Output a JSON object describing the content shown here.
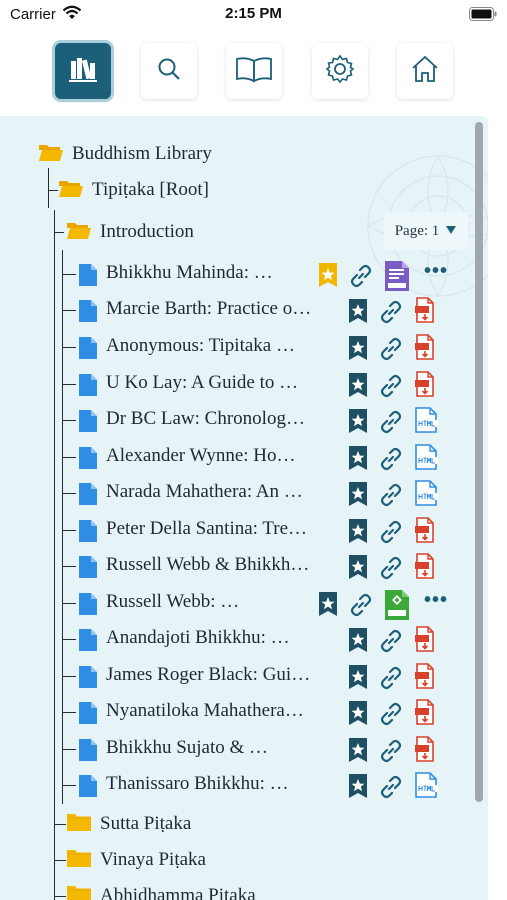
{
  "status_bar": {
    "carrier": "Carrier",
    "time": "2:15 PM"
  },
  "toolbar": {
    "buttons": [
      {
        "icon": "library-icon",
        "active": true
      },
      {
        "icon": "search-icon",
        "active": false
      },
      {
        "icon": "book-icon",
        "active": false
      },
      {
        "icon": "gear-icon",
        "active": false
      },
      {
        "icon": "home-icon",
        "active": false
      }
    ]
  },
  "tree": {
    "root": "Buddhism Library",
    "tipitaka": "Tipiṭaka [Root]",
    "introduction": "Introduction",
    "page_selector": "Page: 1",
    "documents": [
      {
        "title": "Bhikkhu Mahinda: …",
        "starred": true,
        "format": "AZW3",
        "more": true
      },
      {
        "title": "Marcie Barth: Practice o…",
        "starred": false,
        "format": "PDF"
      },
      {
        "title": "Anonymous: Tipitaka …",
        "starred": false,
        "format": "PDF"
      },
      {
        "title": "U Ko Lay: A Guide to …",
        "starred": false,
        "format": "PDF"
      },
      {
        "title": "Dr BC Law: Chronolog…",
        "starred": false,
        "format": "HTML"
      },
      {
        "title": "Alexander Wynne: Ho…",
        "starred": false,
        "format": "HTML"
      },
      {
        "title": "Narada Mahathera: An …",
        "starred": false,
        "format": "HTML"
      },
      {
        "title": "Peter Della Santina: Tre…",
        "starred": false,
        "format": "PDF"
      },
      {
        "title": "Russell Webb & Bhikkh…",
        "starred": false,
        "format": "PDF"
      },
      {
        "title": "Russell Webb: …",
        "starred": false,
        "format": "EPUB",
        "more": true
      },
      {
        "title": "Anandajoti Bhikkhu: …",
        "starred": false,
        "format": "PDF"
      },
      {
        "title": "James Roger Black: Gui…",
        "starred": false,
        "format": "PDF"
      },
      {
        "title": "Nyanatiloka Mahathera…",
        "starred": false,
        "format": "PDF"
      },
      {
        "title": "Bhikkhu Sujato & …",
        "starred": false,
        "format": "PDF"
      },
      {
        "title": "Thanissaro Bhikkhu: …",
        "starred": false,
        "format": "HTML"
      }
    ],
    "folders": [
      "Sutta Piṭaka",
      "Vinaya Piṭaka",
      "Abhidhamma Piṭaka"
    ]
  },
  "colors": {
    "accent": "#1c5f78",
    "folder": "#f5b800",
    "doc": "#2f8de4",
    "pdf": "#d9412b",
    "html": "#2f8de4",
    "epub": "#3aa93a",
    "panel": "#e6f3f7"
  }
}
